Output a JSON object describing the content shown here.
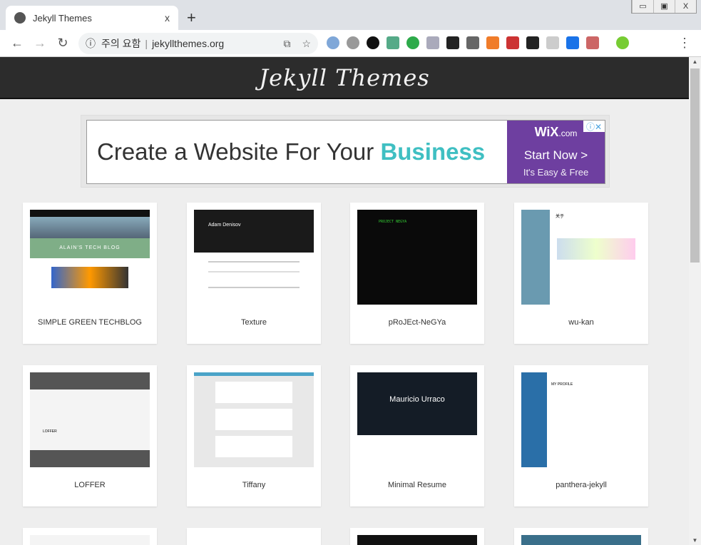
{
  "browser": {
    "tab_title": "Jekyll Themes",
    "new_tab": "+",
    "close": "x",
    "url_warning": "주의 요함",
    "url": "jekyllthemes.org",
    "window_controls": [
      "▭",
      "▣",
      "X"
    ]
  },
  "site": {
    "logo": "Jekyll Themes"
  },
  "ad": {
    "headline": "Create a Website For Your ",
    "headline_emphasis": "Business",
    "brand": "WiX",
    "brand_suffix": ".com",
    "cta": "Start Now >",
    "sub": "It's Easy & Free",
    "info": "ⓘ✕"
  },
  "themes": [
    {
      "name": "SIMPLE GREEN TECHBLOG",
      "thumb_text": "ALAIN'S TECH BLOG"
    },
    {
      "name": "Texture",
      "thumb_text": "Adam Denisov"
    },
    {
      "name": "pRoJEct-NeGYa",
      "thumb_text": "PROJECT NEGYA"
    },
    {
      "name": "wu-kan",
      "thumb_text": "关于"
    },
    {
      "name": "LOFFER",
      "thumb_text": "LOFFER"
    },
    {
      "name": "Tiffany",
      "thumb_text": ""
    },
    {
      "name": "Minimal Resume",
      "thumb_text": "Mauricio Urraco"
    },
    {
      "name": "panthera-jekyll",
      "thumb_text": "MY PROFILE"
    }
  ]
}
